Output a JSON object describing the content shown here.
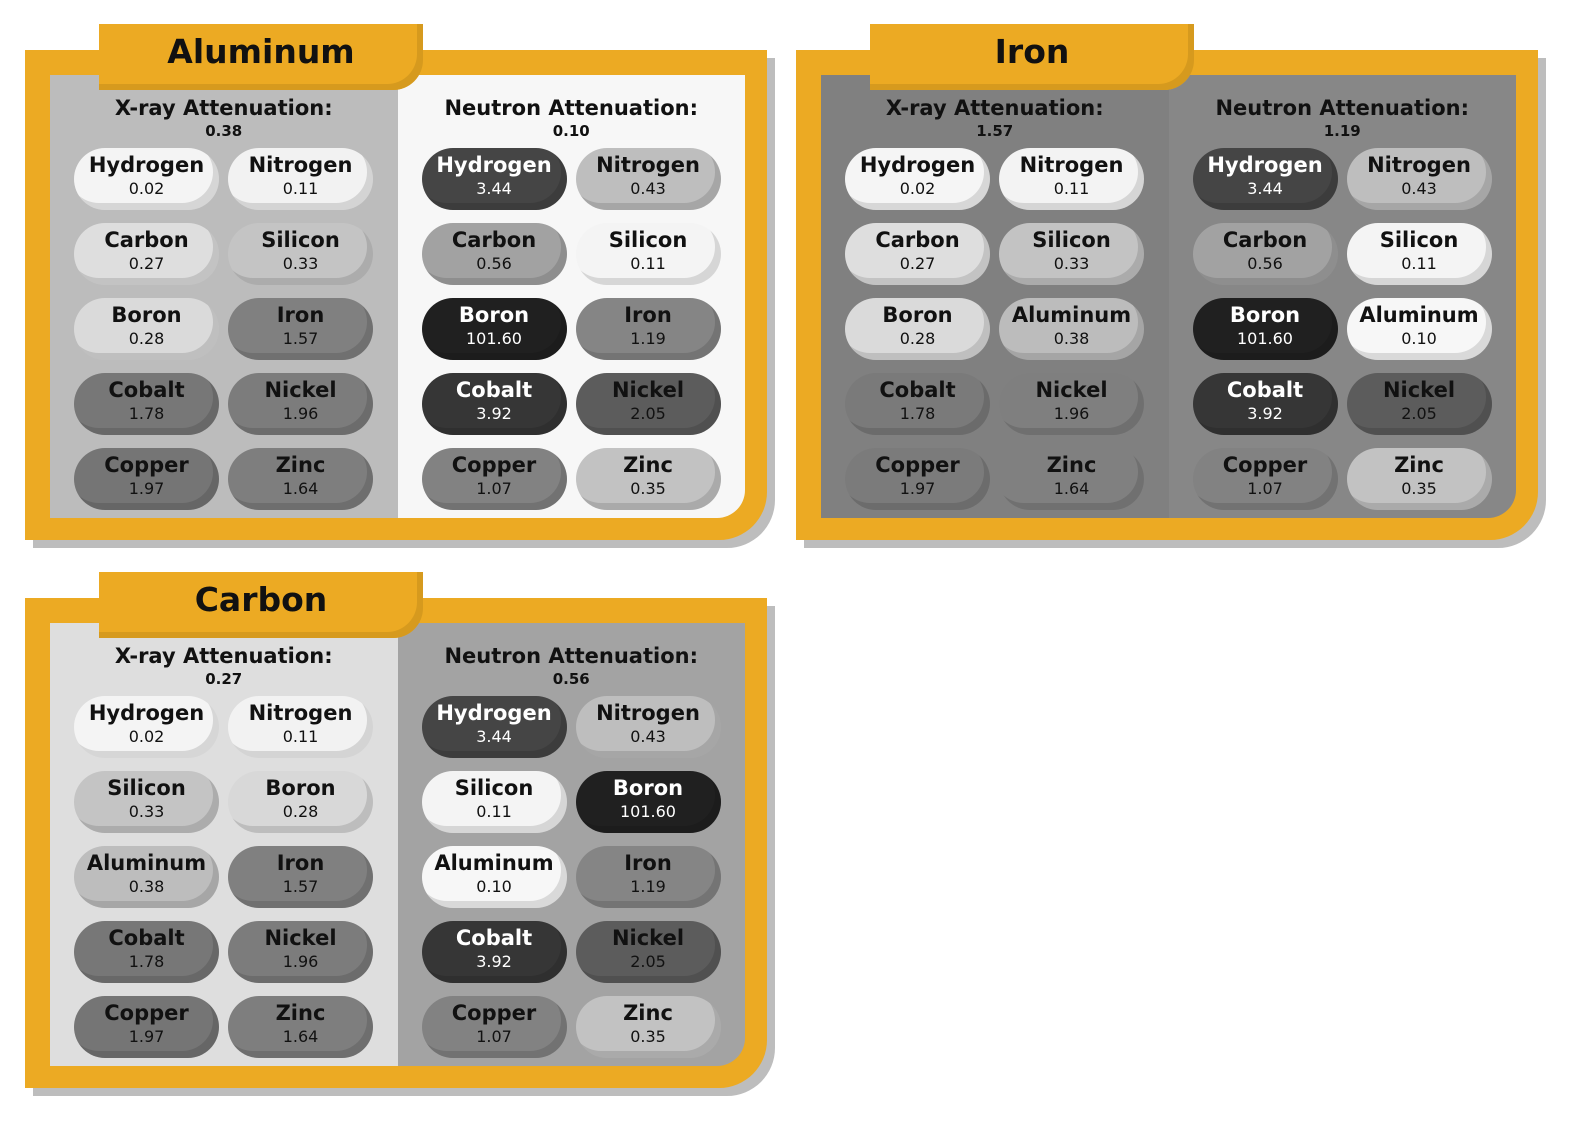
{
  "colors": {
    "frame": "#ecaa23",
    "frame_shadow": "#bdbdbd"
  },
  "cards": [
    {
      "title": "Aluminum",
      "xray": {
        "label": "X-ray Attenuation:",
        "value": "0.38",
        "bg": "#bcbcbc",
        "items": [
          {
            "name": "Hydrogen",
            "value": "0.02",
            "fill": "#f4f4f4",
            "text": "light"
          },
          {
            "name": "Nitrogen",
            "value": "0.11",
            "fill": "#f2f2f2",
            "text": "light"
          },
          {
            "name": "Carbon",
            "value": "0.27",
            "fill": "#dedede",
            "text": "light"
          },
          {
            "name": "Silicon",
            "value": "0.33",
            "fill": "#c4c4c4",
            "text": "light"
          },
          {
            "name": "Boron",
            "value": "0.28",
            "fill": "#dadada",
            "text": "light"
          },
          {
            "name": "Iron",
            "value": "1.57",
            "fill": "#808080",
            "text": "light"
          },
          {
            "name": "Cobalt",
            "value": "1.78",
            "fill": "#777777",
            "text": "light"
          },
          {
            "name": "Nickel",
            "value": "1.96",
            "fill": "#7c7c7c",
            "text": "light"
          },
          {
            "name": "Copper",
            "value": "1.97",
            "fill": "#757575",
            "text": "light"
          },
          {
            "name": "Zinc",
            "value": "1.64",
            "fill": "#7e7e7e",
            "text": "light"
          }
        ]
      },
      "neutron": {
        "label": "Neutron Attenuation:",
        "value": "0.10",
        "bg": "#f7f7f7",
        "items": [
          {
            "name": "Hydrogen",
            "value": "3.44",
            "fill": "#454545",
            "text": "dark"
          },
          {
            "name": "Nitrogen",
            "value": "0.43",
            "fill": "#bebebe",
            "text": "light"
          },
          {
            "name": "Carbon",
            "value": "0.56",
            "fill": "#a2a2a2",
            "text": "light"
          },
          {
            "name": "Silicon",
            "value": "0.11",
            "fill": "#f4f4f4",
            "text": "light"
          },
          {
            "name": "Boron",
            "value": "101.60",
            "fill": "#202020",
            "text": "dark"
          },
          {
            "name": "Iron",
            "value": "1.19",
            "fill": "#858585",
            "text": "light"
          },
          {
            "name": "Cobalt",
            "value": "3.92",
            "fill": "#363636",
            "text": "dark"
          },
          {
            "name": "Nickel",
            "value": "2.05",
            "fill": "#5c5c5c",
            "text": "light"
          },
          {
            "name": "Copper",
            "value": "1.07",
            "fill": "#828282",
            "text": "light"
          },
          {
            "name": "Zinc",
            "value": "0.35",
            "fill": "#c2c2c2",
            "text": "light"
          }
        ]
      }
    },
    {
      "title": "Iron",
      "xray": {
        "label": "X-ray Attenuation:",
        "value": "1.57",
        "bg": "#808080",
        "items": [
          {
            "name": "Hydrogen",
            "value": "0.02",
            "fill": "#f5f5f5",
            "text": "light"
          },
          {
            "name": "Nitrogen",
            "value": "0.11",
            "fill": "#f3f3f3",
            "text": "light"
          },
          {
            "name": "Carbon",
            "value": "0.27",
            "fill": "#dedede",
            "text": "light"
          },
          {
            "name": "Silicon",
            "value": "0.33",
            "fill": "#c3c3c3",
            "text": "light"
          },
          {
            "name": "Boron",
            "value": "0.28",
            "fill": "#dadada",
            "text": "light"
          },
          {
            "name": "Aluminum",
            "value": "0.38",
            "fill": "#bcbcbc",
            "text": "light"
          },
          {
            "name": "Cobalt",
            "value": "1.78",
            "fill": "#7a7a7a",
            "text": "light"
          },
          {
            "name": "Nickel",
            "value": "1.96",
            "fill": "#7f7f7f",
            "text": "light"
          },
          {
            "name": "Copper",
            "value": "1.97",
            "fill": "#7b7b7b",
            "text": "light"
          },
          {
            "name": "Zinc",
            "value": "1.64",
            "fill": "#808080",
            "text": "light"
          }
        ]
      },
      "neutron": {
        "label": "Neutron Attenuation:",
        "value": "1.19",
        "bg": "#878787",
        "items": [
          {
            "name": "Hydrogen",
            "value": "3.44",
            "fill": "#454545",
            "text": "dark"
          },
          {
            "name": "Nitrogen",
            "value": "0.43",
            "fill": "#bebebe",
            "text": "light"
          },
          {
            "name": "Carbon",
            "value": "0.56",
            "fill": "#a2a2a2",
            "text": "light"
          },
          {
            "name": "Silicon",
            "value": "0.11",
            "fill": "#f4f4f4",
            "text": "light"
          },
          {
            "name": "Boron",
            "value": "101.60",
            "fill": "#202020",
            "text": "dark"
          },
          {
            "name": "Aluminum",
            "value": "0.10",
            "fill": "#f7f7f7",
            "text": "light"
          },
          {
            "name": "Cobalt",
            "value": "3.92",
            "fill": "#363636",
            "text": "dark"
          },
          {
            "name": "Nickel",
            "value": "2.05",
            "fill": "#5c5c5c",
            "text": "light"
          },
          {
            "name": "Copper",
            "value": "1.07",
            "fill": "#828282",
            "text": "light"
          },
          {
            "name": "Zinc",
            "value": "0.35",
            "fill": "#c2c2c2",
            "text": "light"
          }
        ]
      }
    },
    {
      "title": "Carbon",
      "xray": {
        "label": "X-ray Attenuation:",
        "value": "0.27",
        "bg": "#dedede",
        "items": [
          {
            "name": "Hydrogen",
            "value": "0.02",
            "fill": "#f4f4f4",
            "text": "light"
          },
          {
            "name": "Nitrogen",
            "value": "0.11",
            "fill": "#f2f2f2",
            "text": "light"
          },
          {
            "name": "Silicon",
            "value": "0.33",
            "fill": "#c4c4c4",
            "text": "light"
          },
          {
            "name": "Boron",
            "value": "0.28",
            "fill": "#d8d8d8",
            "text": "light"
          },
          {
            "name": "Aluminum",
            "value": "0.38",
            "fill": "#bdbdbd",
            "text": "light"
          },
          {
            "name": "Iron",
            "value": "1.57",
            "fill": "#808080",
            "text": "light"
          },
          {
            "name": "Cobalt",
            "value": "1.78",
            "fill": "#777777",
            "text": "light"
          },
          {
            "name": "Nickel",
            "value": "1.96",
            "fill": "#7c7c7c",
            "text": "light"
          },
          {
            "name": "Copper",
            "value": "1.97",
            "fill": "#757575",
            "text": "light"
          },
          {
            "name": "Zinc",
            "value": "1.64",
            "fill": "#7e7e7e",
            "text": "light"
          }
        ]
      },
      "neutron": {
        "label": "Neutron Attenuation:",
        "value": "0.56",
        "bg": "#a3a3a3",
        "items": [
          {
            "name": "Hydrogen",
            "value": "3.44",
            "fill": "#454545",
            "text": "dark"
          },
          {
            "name": "Nitrogen",
            "value": "0.43",
            "fill": "#bebebe",
            "text": "light"
          },
          {
            "name": "Silicon",
            "value": "0.11",
            "fill": "#f4f4f4",
            "text": "light"
          },
          {
            "name": "Boron",
            "value": "101.60",
            "fill": "#202020",
            "text": "dark"
          },
          {
            "name": "Aluminum",
            "value": "0.10",
            "fill": "#f7f7f7",
            "text": "light"
          },
          {
            "name": "Iron",
            "value": "1.19",
            "fill": "#858585",
            "text": "light"
          },
          {
            "name": "Cobalt",
            "value": "3.92",
            "fill": "#363636",
            "text": "dark"
          },
          {
            "name": "Nickel",
            "value": "2.05",
            "fill": "#5c5c5c",
            "text": "light"
          },
          {
            "name": "Copper",
            "value": "1.07",
            "fill": "#828282",
            "text": "light"
          },
          {
            "name": "Zinc",
            "value": "0.35",
            "fill": "#c2c2c2",
            "text": "light"
          }
        ]
      }
    }
  ]
}
